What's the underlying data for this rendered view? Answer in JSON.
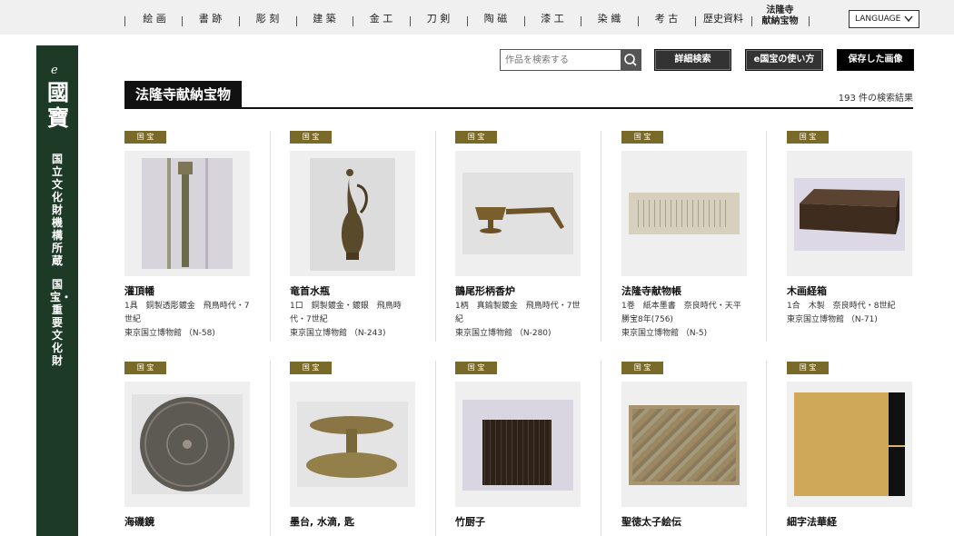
{
  "nav": {
    "items": [
      "絵 画",
      "書 跡",
      "彫 刻",
      "建 築",
      "金 工",
      "刀 剣",
      "陶 磁",
      "漆 工",
      "染 織",
      "考 古",
      "歴史資料"
    ],
    "active_line1": "法隆寺",
    "active_line2": "献納宝物",
    "language": "LANGUAGE"
  },
  "sidebar": {
    "logo_e": "e",
    "logo_text": "國寶",
    "vertical_1": "国立文化財機構所蔵",
    "vertical_2": "国宝・重要文化財"
  },
  "search": {
    "placeholder": "作品を検索する"
  },
  "buttons": {
    "advanced": "詳細検索",
    "howto": "e国宝の使い方",
    "saved": "保存した画像"
  },
  "page": {
    "title": "法隆寺献納宝物",
    "results": "193 件の検索結果"
  },
  "colors": {
    "sidebar": "#1c3a25",
    "badge": "#7a6a2a"
  },
  "items": [
    {
      "badge": "国 宝",
      "title": "灌頂幡",
      "desc": "1具　銅製透彫鍍金　飛鳥時代・7世紀",
      "loc": "東京国立博物館 （N-58)"
    },
    {
      "badge": "国 宝",
      "title": "竜首水瓶",
      "desc": "1口　銅製鍍金・鍍銀　飛鳥時代・7世紀",
      "loc": "東京国立博物館 （N-243)"
    },
    {
      "badge": "国 宝",
      "title": "鵲尾形柄香炉",
      "desc": "1柄　真鍮製鍍金　飛鳥時代・7世紀",
      "loc": "東京国立博物館 （N-280)"
    },
    {
      "badge": "国 宝",
      "title": "法隆寺献物帳",
      "desc": "1巻　紙本墨書　奈良時代・天平勝宝8年(756)",
      "loc": "東京国立博物館 （N-5)"
    },
    {
      "badge": "国 宝",
      "title": "木画経箱",
      "desc": "1合　木製　奈良時代・8世紀",
      "loc": "東京国立博物館 （N-71)"
    },
    {
      "badge": "国 宝",
      "title": "海磯鏡",
      "desc": "",
      "loc": ""
    },
    {
      "badge": "国 宝",
      "title": "墨台, 水滴, 匙",
      "desc": "",
      "loc": ""
    },
    {
      "badge": "国 宝",
      "title": "竹厨子",
      "desc": "",
      "loc": ""
    },
    {
      "badge": "国 宝",
      "title": "聖徳太子絵伝",
      "desc": "",
      "loc": ""
    },
    {
      "badge": "国 宝",
      "title": "細字法華経",
      "desc": "",
      "loc": ""
    }
  ]
}
